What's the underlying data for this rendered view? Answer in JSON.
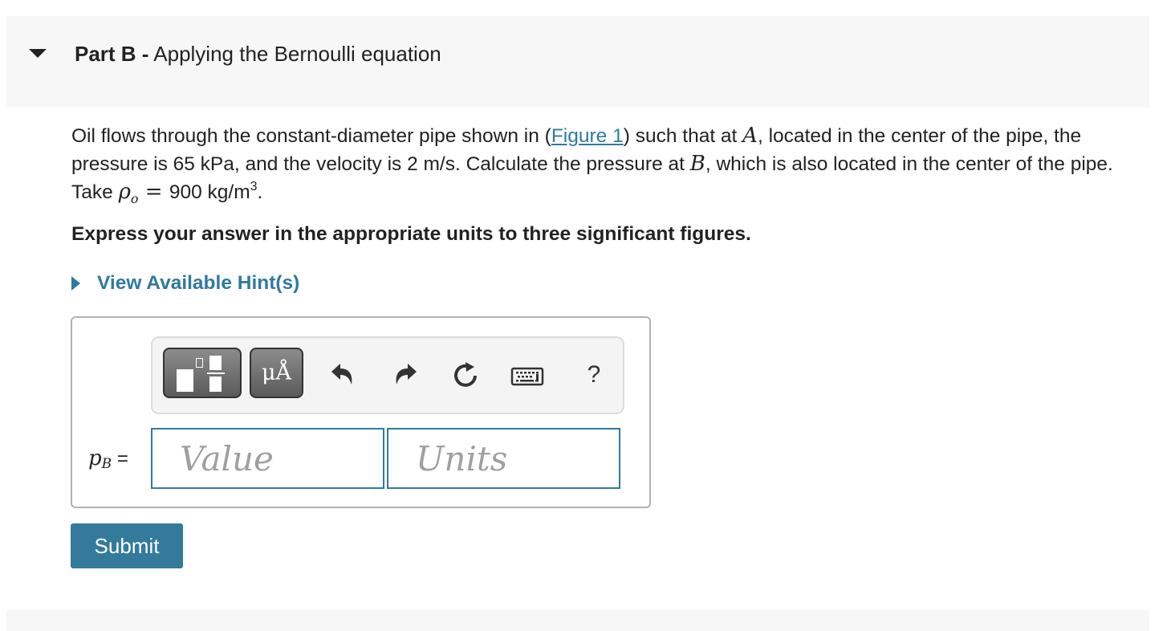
{
  "part": {
    "label": "Part B -",
    "title": "Applying the Bernoulli equation",
    "expanded": true
  },
  "problem": {
    "text_1": "Oil flows through the constant-diameter pipe shown in (",
    "figure_link": "Figure 1",
    "text_2": ") such that at ",
    "point_a": "A",
    "text_3": ", located in the center of the pipe, the pressure is 65 kPa, and the velocity is 2 m/s. Calculate the pressure at ",
    "point_b": "B",
    "text_4": ", which is also located in the center of the pipe. Take ",
    "rho": "ρ",
    "rho_sub": "o",
    "equals": " = ",
    "density_value": "900 kg/m",
    "density_exp": "3",
    "end": "."
  },
  "instruction": "Express your answer in the appropriate units to three significant figures.",
  "hints": {
    "label": "View Available Hint(s)"
  },
  "toolbar": {
    "templates_icon": "templates-icon",
    "units_label": "μÅ",
    "undo_icon": "undo-icon",
    "redo_icon": "redo-icon",
    "reset_icon": "reset-icon",
    "keyboard_icon": "keyboard-icon",
    "help_label": "?"
  },
  "answer": {
    "variable": "p",
    "variable_sub": "B",
    "equals": "=",
    "value_placeholder": "Value",
    "units_placeholder": "Units",
    "value": "",
    "units": ""
  },
  "submit_label": "Submit",
  "colors": {
    "accent": "#347a9a",
    "link": "#2f7aa0",
    "panel_bg": "#f7f7f7"
  }
}
